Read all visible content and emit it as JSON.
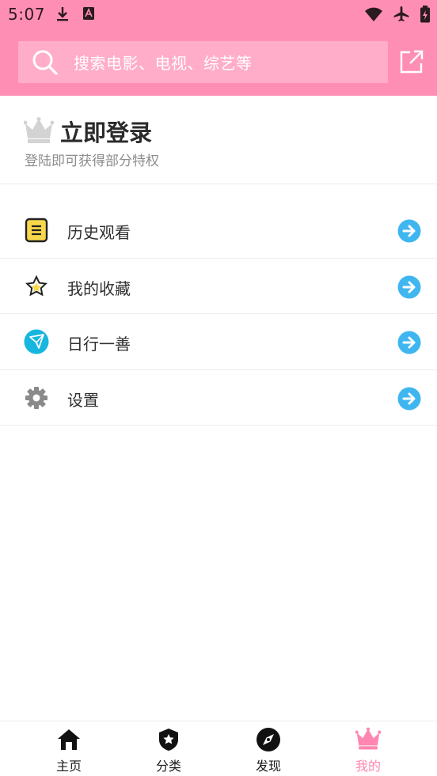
{
  "status_bar": {
    "time": "5:07"
  },
  "header": {
    "search_placeholder": "搜索电影、电视、综艺等"
  },
  "login": {
    "title": "立即登录",
    "subtitle": "登陆即可获得部分特权"
  },
  "menu": {
    "items": [
      {
        "label": "历史观看",
        "icon": "history-list-icon"
      },
      {
        "label": "我的收藏",
        "icon": "star-icon"
      },
      {
        "label": "日行一善",
        "icon": "paper-plane-icon"
      },
      {
        "label": "设置",
        "icon": "gear-icon"
      }
    ]
  },
  "tabbar": {
    "tabs": [
      {
        "label": "主页",
        "icon": "home-icon"
      },
      {
        "label": "分类",
        "icon": "shield-star-icon"
      },
      {
        "label": "发现",
        "icon": "compass-icon"
      },
      {
        "label": "我的",
        "icon": "crown-icon",
        "active": true
      }
    ]
  },
  "colors": {
    "brand": "#ff8eb5",
    "arrow": "#3fb6f0",
    "active_tab": "#ff86b0"
  }
}
